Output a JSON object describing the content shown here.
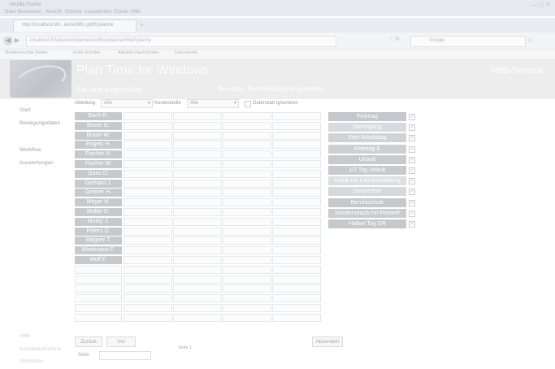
{
  "browser": {
    "app_title": "Mozilla Firefox",
    "menu": [
      "Datei",
      "Bearbeiten",
      "Ansicht",
      "Chronik",
      "Lesezeichen",
      "Extras",
      "Hilfe"
    ],
    "tab_label": "http://localhost:80...iert/eOffic.gtdf0.planne",
    "new_tab": "+",
    "url": "localhost:80/planner/planner/eoffice/planner/MoP.planne",
    "search_placeholder": "Google",
    "bookmarks": [
      "Meistbesuchte Seiten",
      "Erste Schritte",
      "Aktuelle Nachrichten",
      "Dokumente"
    ]
  },
  "header": {
    "app_heading": "Plan Time for Windows",
    "brand": "PMB-Terminal",
    "user_status": "Sie sind angemeldet",
    "login_status": "Benutzer: Beschreibung angemeldet"
  },
  "sidebar": {
    "items": [
      "Start",
      "Bewegungsdaten",
      "Workflow",
      "Auswertungen"
    ],
    "bottom_items": [
      "Hilfe",
      "Kontaktaufnahme",
      "Abmelden"
    ]
  },
  "filters": {
    "label1": "Abteilung",
    "select1": "Alle",
    "label2": "Kostenstelle",
    "select2": "Alle",
    "checkbox_label": "Datenstatt ignorieren"
  },
  "names": [
    "Bach R.",
    "Braun G.",
    "Braun W.",
    "Engels H.",
    "Fischer H.",
    "Fischer W.",
    "Gans D.",
    "Gerhard J.",
    "Greiner H.",
    "Meyer H.",
    "Müller D.",
    "Moritz J.",
    "Peters D.",
    "Wagner T.",
    "Weidmann F.",
    "Wolf F."
  ],
  "legend": [
    {
      "label": "Feiertag",
      "color": "#c4c7cb"
    },
    {
      "label": "Dienstgang",
      "color": "#d8dadd"
    },
    {
      "label": "Kein Arbeitstag",
      "color": "#d0d3d6"
    },
    {
      "label": "Feiertag E",
      "color": "#cdd0d3"
    },
    {
      "label": "Urlaub",
      "color": "#c8cbce"
    },
    {
      "label": "1/2 Tag Urlaub",
      "color": "#c8cbce"
    },
    {
      "label": "Krank mit Lohnfortzahlung",
      "color": "#dcdee0"
    },
    {
      "label": "Dienstreise",
      "color": "#d6d8db"
    },
    {
      "label": "Berufsschule",
      "color": "#c6c9cc"
    },
    {
      "label": "Sonderurlaub mit Freistell",
      "color": "#c9ccd0"
    },
    {
      "label": "Halber Tag DR",
      "color": "#c6c9cc"
    }
  ],
  "pager": {
    "back": "Zurück",
    "forward": "Vor",
    "page_info": "Seite 1",
    "goto_label": "Seite",
    "absenden": "Absenden"
  }
}
